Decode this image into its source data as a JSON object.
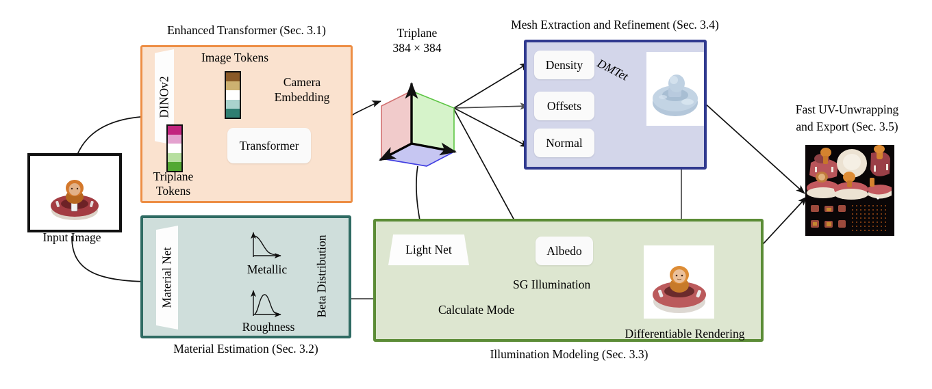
{
  "figure": {
    "type": "architecture-pipeline-diagram",
    "sections": [
      {
        "id": "enhanced_transformer",
        "caption": "Enhanced Transformer (Sec.  3.1)",
        "accent": "#ed8e45",
        "fill": "#fae2cf"
      },
      {
        "id": "material_estimation",
        "caption": "Material Estimation (Sec.  3.2)",
        "accent": "#2f6b63",
        "fill": "#cfdedb"
      },
      {
        "id": "illumination_modeling",
        "caption": "Illumination Modeling (Sec.  3.3)",
        "accent": "#5b8c36",
        "fill": "#dde6d0"
      },
      {
        "id": "mesh_extraction",
        "caption": "Mesh Extraction and Refinement (Sec.  3.4)",
        "accent": "#303a8f",
        "fill": "#d3d6ea"
      },
      {
        "id": "uv_export",
        "caption_line1": "Fast UV-Unwrapping",
        "caption_line2": "and Export (Sec.  3.5)"
      }
    ]
  },
  "input": {
    "caption": "Input Image",
    "alt": "photo of a toy figure in a red inflatable boat"
  },
  "transformer_block": {
    "title": "Enhanced Transformer (Sec.  3.1)",
    "dinov2_label": "DINOv2",
    "image_tokens_label": "Image Tokens",
    "camera_embedding_label_line1": "Camera",
    "camera_embedding_label_line2": "Embedding",
    "triplane_tokens_label_line1": "Triplane",
    "triplane_tokens_label_line2": "Tokens",
    "transformer_label": "Transformer",
    "image_token_colors": [
      "#8a5a27",
      "#cdb171",
      "#ffffff",
      "#a9d3cd",
      "#2f7f72"
    ],
    "triplane_token_colors": [
      "#c2247f",
      "#e4a2cf",
      "#ffffff",
      "#b7dfa0",
      "#52a832"
    ]
  },
  "triplane": {
    "title": "Triplane",
    "resolution": "384 × 384",
    "planes": [
      {
        "name": "xy-plane",
        "color": "#f1c9c9",
        "stroke": "#d06a6a"
      },
      {
        "name": "yz-plane",
        "color": "#d4f3c8",
        "stroke": "#55c23a"
      },
      {
        "name": "xz-plane",
        "color": "#c3c4f2",
        "stroke": "#3734e0"
      }
    ]
  },
  "material_block": {
    "title": "Material Estimation (Sec.  3.2)",
    "material_net_label": "Material Net",
    "metallic_label": "Metallic",
    "roughness_label": "Roughness",
    "beta_distribution_label": "Beta Distribution"
  },
  "mesh_block": {
    "title": "Mesh Extraction and Refinement (Sec.  3.4)",
    "nodes": [
      "Density",
      "Offsets",
      "Normal"
    ],
    "dmtet_label": "DMTet",
    "mesh_alt": "untextured light-blue 3D mesh of the boat toy"
  },
  "illumination_block": {
    "title": "Illumination Modeling (Sec.  3.3)",
    "light_net_label": "Light Net",
    "albedo_label": "Albedo",
    "sg_illumination_label": "SG Illumination",
    "calculate_mode_label": "Calculate Mode",
    "differentiable_rendering_label": "Differentiable Rendering",
    "render_alt": "textured render of the boat toy"
  },
  "uv_block": {
    "title_line1": "Fast UV-Unwrapping",
    "title_line2": "and Export (Sec.  3.5)",
    "atlas_alt": "UV texture atlas on black background with red and cream patches"
  }
}
